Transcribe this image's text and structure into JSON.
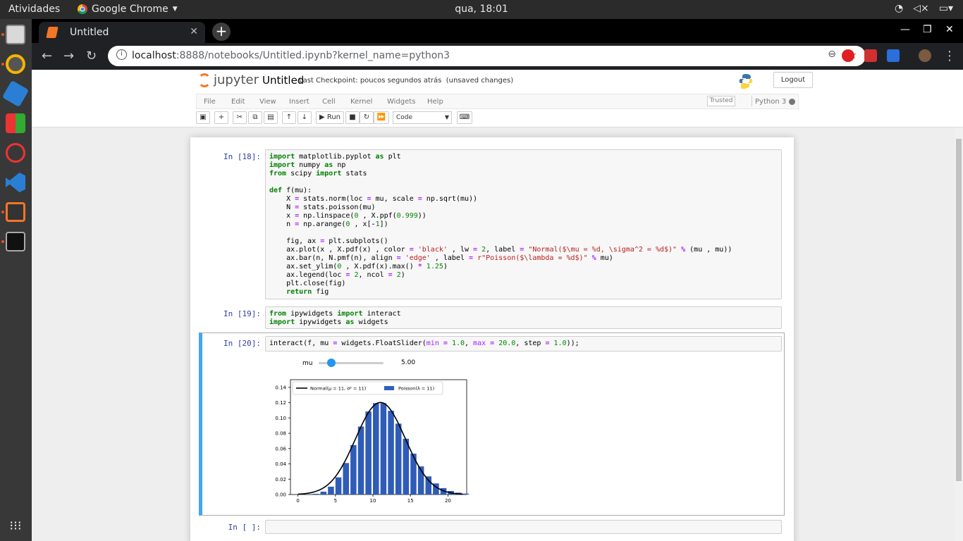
{
  "topbar": {
    "activities": "Atividades",
    "app_name": "Google Chrome",
    "clock": "qua, 18:01"
  },
  "browser": {
    "tab_title": "Untitled",
    "url_host": "localhost",
    "url_rest": ":8888/notebooks/Untitled.ipynb?kernel_name=python3"
  },
  "jupyter": {
    "logo_text": "jupyter",
    "notebook_name": "Untitled",
    "checkpoint": "Last Checkpoint: poucos segundos atrás",
    "unsaved": "(unsaved changes)",
    "logout": "Logout",
    "menu": [
      "File",
      "Edit",
      "View",
      "Insert",
      "Cell",
      "Kernel",
      "Widgets",
      "Help"
    ],
    "trusted": "Trusted",
    "kernel": "Python 3",
    "run_label": "Run",
    "cell_type": "Code"
  },
  "cells": [
    {
      "prompt": "In [18]:"
    },
    {
      "prompt": "In [19]:"
    },
    {
      "prompt": "In [20]:"
    },
    {
      "prompt": "In [ ]:"
    }
  ],
  "widget": {
    "slider_label": "mu",
    "slider_value": "5.00",
    "slider_min": 1.0,
    "slider_max": 20.0,
    "slider_position_value": 5.0
  },
  "chart_data": {
    "type": "bar",
    "xticks": [
      "0",
      "5",
      "10",
      "15",
      "20"
    ],
    "yticks": [
      "0.00",
      "0.02",
      "0.04",
      "0.06",
      "0.08",
      "0.10",
      "0.12",
      "0.14"
    ],
    "ylim": [
      0,
      0.15
    ],
    "xlim": [
      -1,
      22.5
    ],
    "legend": [
      {
        "name": "Normal(μ = 11, σ² = 11)",
        "style": "line",
        "color": "#000000"
      },
      {
        "name": "Poisson(λ = 11)",
        "style": "bar",
        "color": "#3060c0"
      }
    ],
    "legend_placement": "top-left",
    "bar_color": "#2e5cb8",
    "bars": {
      "x": [
        0,
        1,
        2,
        3,
        4,
        5,
        6,
        7,
        8,
        9,
        10,
        11,
        12,
        13,
        14,
        15,
        16,
        17,
        18,
        19,
        20,
        21,
        22
      ],
      "values": [
        0.0,
        0.0002,
        0.001,
        0.0037,
        0.0102,
        0.0224,
        0.0411,
        0.0646,
        0.0888,
        0.1085,
        0.1194,
        0.1194,
        0.1094,
        0.0926,
        0.0728,
        0.0534,
        0.0367,
        0.0237,
        0.0145,
        0.0084,
        0.0046,
        0.0024,
        0.0012
      ]
    },
    "normal": {
      "mu": 11,
      "sigma2": 11,
      "x_from": 0,
      "x_to": 22
    }
  }
}
